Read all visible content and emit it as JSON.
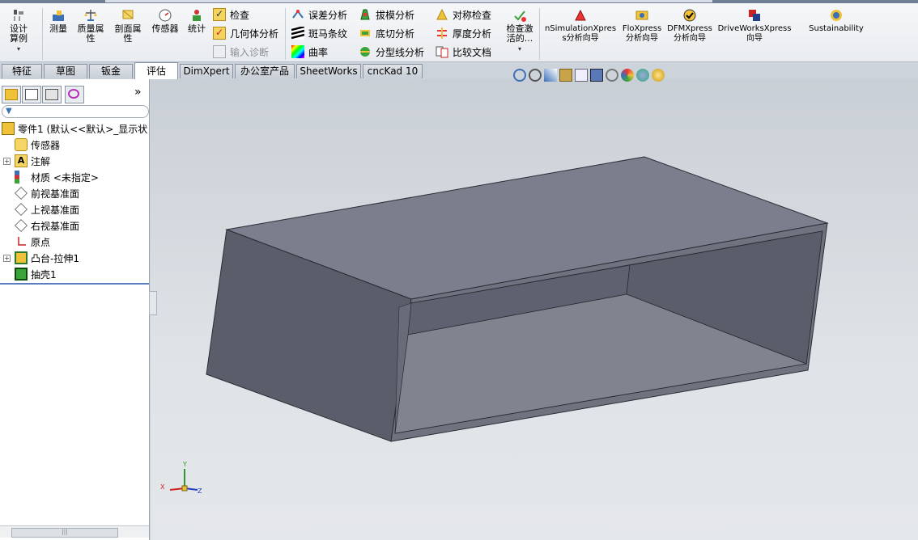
{
  "ribbon": {
    "big_buttons": [
      {
        "label": "设计算例",
        "icon": "design-study-icon"
      },
      {
        "label": "测量",
        "icon": "measure-icon"
      },
      {
        "label": "质量属性",
        "icon": "mass-properties-icon"
      },
      {
        "label": "剖面属性",
        "icon": "section-properties-icon"
      },
      {
        "label": "传感器",
        "icon": "sensor-icon"
      },
      {
        "label": "统计",
        "icon": "statistics-icon"
      }
    ],
    "check_group": [
      {
        "label": "检查",
        "icon": "check-icon",
        "disabled": false
      },
      {
        "label": "几何体分析",
        "icon": "geometry-analysis-icon",
        "disabled": false
      },
      {
        "label": "输入诊断",
        "icon": "import-diagnostics-icon",
        "disabled": true
      }
    ],
    "analysis_group": [
      {
        "label": "误差分析",
        "icon": "deviation-analysis-icon"
      },
      {
        "label": "斑马条纹",
        "icon": "zebra-stripes-icon"
      },
      {
        "label": "曲率",
        "icon": "curvature-icon"
      }
    ],
    "draft_group": [
      {
        "label": "拔模分析",
        "icon": "draft-analysis-icon"
      },
      {
        "label": "底切分析",
        "icon": "undercut-analysis-icon"
      },
      {
        "label": "分型线分析",
        "icon": "parting-line-analysis-icon"
      }
    ],
    "symmetry_group": [
      {
        "label": "对称检查",
        "icon": "symmetry-check-icon"
      },
      {
        "label": "厚度分析",
        "icon": "thickness-analysis-icon"
      },
      {
        "label": "比较文档",
        "icon": "compare-documents-icon"
      }
    ],
    "check_active": {
      "label": "检查激活的...",
      "icon": "check-active-icon"
    },
    "xpress": [
      {
        "label": "nSimulationXpress分析向导",
        "icon": "simulationxpress-icon"
      },
      {
        "label": "FloXpress分析向导",
        "icon": "floxpress-icon"
      },
      {
        "label": "DFMXpress分析向导",
        "icon": "dfmxpress-icon"
      },
      {
        "label": "DriveWorksXpress向导",
        "icon": "driveworksxpress-icon"
      },
      {
        "label": "Sustainability",
        "icon": "sustainability-icon"
      }
    ]
  },
  "tabs": [
    {
      "label": "特征",
      "active": false
    },
    {
      "label": "草图",
      "active": false
    },
    {
      "label": "钣金",
      "active": false
    },
    {
      "label": "评估",
      "active": true
    },
    {
      "label": "DimXpert",
      "active": false
    },
    {
      "label": "办公室产品",
      "active": false
    },
    {
      "label": "SheetWorks",
      "active": false
    },
    {
      "label": "cncKad 10",
      "active": false
    }
  ],
  "tree": {
    "root": "零件1 (默认<<默认>_显示状",
    "items": [
      {
        "label": "传感器",
        "icon": "sensor-folder-icon",
        "expandable": false
      },
      {
        "label": "注解",
        "icon": "annotations-icon",
        "expandable": true
      },
      {
        "label": "材质 <未指定>",
        "icon": "material-icon",
        "expandable": false
      },
      {
        "label": "前视基准面",
        "icon": "plane-icon",
        "expandable": false
      },
      {
        "label": "上视基准面",
        "icon": "plane-icon",
        "expandable": false
      },
      {
        "label": "右视基准面",
        "icon": "plane-icon",
        "expandable": false
      },
      {
        "label": "原点",
        "icon": "origin-icon",
        "expandable": false
      },
      {
        "label": "凸台-拉伸1",
        "icon": "boss-extrude-icon",
        "expandable": true
      },
      {
        "label": "抽壳1",
        "icon": "shell-icon",
        "expandable": false
      }
    ]
  },
  "collapse_panel_label": "»",
  "triad": {
    "x": "X",
    "y": "Y",
    "z": "Z"
  },
  "colors": {
    "accent": "#5a7ebf",
    "model_top": "#7b7f8d",
    "model_side": "#5a5e6b"
  }
}
